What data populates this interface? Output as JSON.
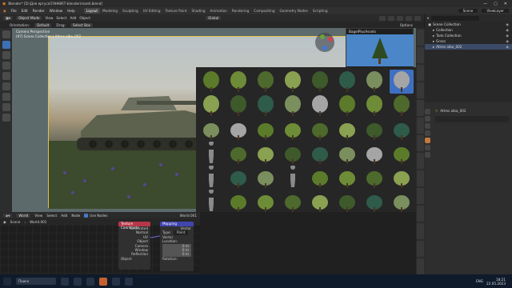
{
  "window": {
    "title": "Blender* [D:\\Для яргуса\\ТАНКИ\\Т-blender\\mantl.blend]",
    "scene": "Scene",
    "view_layer": "ViewLayer"
  },
  "menu": [
    "File",
    "Edit",
    "Render",
    "Window",
    "Help"
  ],
  "workspaces": [
    "Layout",
    "Modeling",
    "Sculpting",
    "UV Editing",
    "Texture Paint",
    "Shading",
    "Animation",
    "Rendering",
    "Compositing",
    "Geometry Nodes",
    "Scripting"
  ],
  "header3d": {
    "mode": "Object Mode",
    "items": [
      "View",
      "Select",
      "Add",
      "Object"
    ],
    "transform": "Global"
  },
  "subheader": {
    "orientation": "Orientation:",
    "orientation_value": "Default",
    "drag": "Drag:",
    "drag_value": "Select Box",
    "options": "Options"
  },
  "viewport": {
    "title": "Camera Perspective",
    "collection": "(97) Scene Collection | Atlres alba_002"
  },
  "asset_browser": {
    "panel_title": "BagelPlusAssets",
    "rows": 8,
    "cols": 8,
    "selected_index": 7
  },
  "outliner": {
    "rows": [
      {
        "label": "Scene Collection",
        "level": 0,
        "selected": false
      },
      {
        "label": "Collection",
        "level": 1,
        "selected": false
      },
      {
        "label": "Tank Collection",
        "level": 1,
        "selected": false
      },
      {
        "label": "Grass",
        "level": 1,
        "selected": false
      },
      {
        "label": "Atlres alba_002",
        "level": 1,
        "selected": true
      }
    ]
  },
  "properties": {
    "object_name": "Atlres alba_002"
  },
  "side_tabs": [
    "Item",
    "Tool",
    "View",
    "Real Snow",
    "BB Math Material",
    "BlenderKit",
    "BagelFix",
    "Create",
    "Edit",
    "Bagel Noise",
    "Quick Sets",
    "Grid",
    "Shortcuts",
    "Sprite"
  ],
  "node_editor": {
    "header": {
      "type": "World",
      "items": [
        "View",
        "Select",
        "Add",
        "Node"
      ],
      "use_nodes": "Use Nodes",
      "slot": "World.001"
    },
    "header2": {
      "scene": "Scene",
      "world": "World.001"
    },
    "node_texcoord": {
      "title": "Texture Coordinate",
      "outputs": [
        "Generated",
        "Normal",
        "UV",
        "Object",
        "Camera",
        "Window",
        "Reflection"
      ],
      "object_label": "Object"
    },
    "node_mapping": {
      "title": "Mapping",
      "output": "Vector",
      "type_label": "Type:",
      "type_value": "Point",
      "vector": "Vector",
      "location": "Location:",
      "loc_values": [
        "0 m",
        "0 m",
        "0 m"
      ],
      "rotation": "Rotation:"
    }
  },
  "status": {
    "time": "18:21",
    "date": "22.05.2023",
    "lang": "ENG",
    "search_placeholder": "Поиск"
  },
  "colors": {
    "accent": "#3f6fc1",
    "outline_yellow": "#e0c14a",
    "status_bg": "#0f1b2b"
  }
}
